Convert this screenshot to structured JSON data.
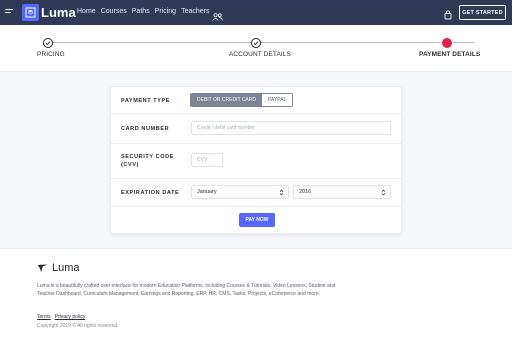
{
  "nav": {
    "brand": "Luma",
    "links": [
      "Home",
      "Courses",
      "Paths",
      "Pricing",
      "Teachers"
    ],
    "cta": "GET STARTED"
  },
  "stepper": {
    "steps": [
      {
        "label": "PRICING",
        "state": "completed"
      },
      {
        "label": "ACCOUNT DETAILS",
        "state": "completed"
      },
      {
        "label": "PAYMENT DETAILS",
        "state": "current"
      }
    ]
  },
  "form": {
    "payment_type_label": "PAYMENT TYPE",
    "payment_options": [
      "DEBIT OR CREDIT CARD",
      "PAYPAL"
    ],
    "selected_payment": "DEBIT OR CREDIT CARD",
    "card_number_label": "CARD NUMBER",
    "card_number_placeholder": "Credit / debit card number",
    "cvv_label_line1": "SECURITY CODE",
    "cvv_label_line2": "(CVV)",
    "cvv_placeholder": "CVV",
    "expiration_label": "EXPIRATION DATE",
    "month_value": "January",
    "year_value": "2016",
    "submit": "PAY NOW"
  },
  "footer": {
    "brand": "Luma",
    "description": "Luma is a beautifully crafted user interface for modern Education Platforms, including Courses & Tutorials, Video Lessons, Student and Teacher Dashboard, Curriculum Management, Earnings and Reporting, ERP, HR, CMS, Tasks, Projects, eCommerce and more.",
    "links": [
      "Terms",
      "Privacy policy"
    ],
    "copyright": "Copyright 2019 © All rights reserved."
  },
  "colors": {
    "nav_bg": "#303956",
    "accent": "#5567ff",
    "current_step": "#e21f4e"
  }
}
